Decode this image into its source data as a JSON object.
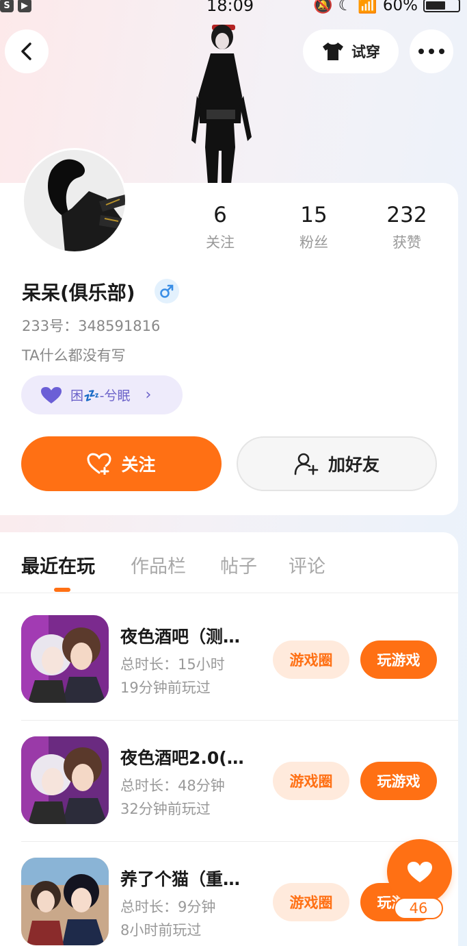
{
  "status_bar": {
    "time": "18:09",
    "battery": "60%",
    "battery_level": 0.6
  },
  "header": {
    "try_on_label": "试穿",
    "back_icon": "chevron-left-icon",
    "try_on_icon": "tshirt-icon",
    "more_icon": "more-dots-icon"
  },
  "profile": {
    "stats": [
      {
        "value": "6",
        "label": "关注"
      },
      {
        "value": "15",
        "label": "粉丝"
      },
      {
        "value": "232",
        "label": "获赞"
      }
    ],
    "nickname": "呆呆(俱乐部)",
    "gender_icon": "male-icon",
    "uid": "233号：348591816",
    "bio": "TA什么都没有写",
    "status_text": "困💤-兮眠",
    "follow_label": "关注",
    "add_friend_label": "加好友"
  },
  "tabs": [
    {
      "label": "最近在玩",
      "active": true
    },
    {
      "label": "作品栏",
      "active": false
    },
    {
      "label": "帖子",
      "active": false
    },
    {
      "label": "评论",
      "active": false
    }
  ],
  "games": [
    {
      "title": "夜色酒吧（测…",
      "duration": "总时长：15小时",
      "last_played": "19分钟前玩过",
      "circle_label": "游戏圈",
      "play_label": "玩游戏"
    },
    {
      "title": "夜色酒吧2.0(…",
      "duration": "总时长：48分钟",
      "last_played": "32分钟前玩过",
      "circle_label": "游戏圈",
      "play_label": "玩游戏"
    },
    {
      "title": "养了个猫（重…",
      "duration": "总时长：9分钟",
      "last_played": "8小时前玩过",
      "circle_label": "游戏圈",
      "play_label": "玩游戏"
    }
  ],
  "fab": {
    "count": "46",
    "icon": "heart-icon"
  },
  "colors": {
    "accent": "#ff7014",
    "accent_light": "#ffeadc",
    "status_pill_bg": "#eeebfb",
    "status_pill_text": "#6b62c9"
  }
}
